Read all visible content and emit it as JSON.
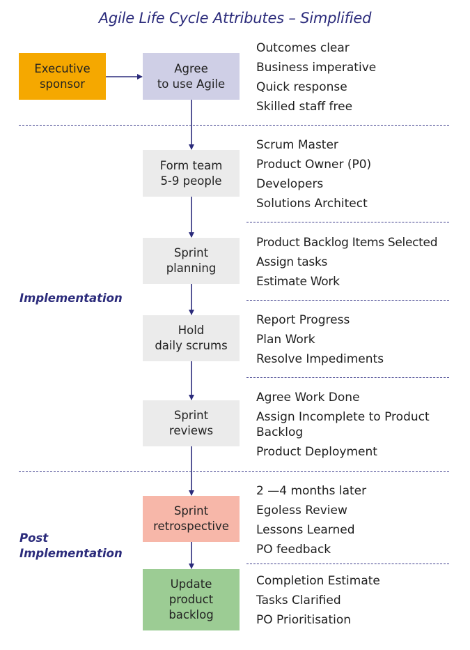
{
  "title": "Agile Life Cycle Attributes – Simplified",
  "colors": {
    "navy": "#2b2b7b",
    "executive_sponsor_fill": "#f5a800",
    "agree_fill": "#cfcfe6",
    "step_fill": "#ebebeb",
    "retrospective_fill": "#f7b7a9",
    "update_backlog_fill": "#9ccc94"
  },
  "phases": {
    "implementation": "Implementation",
    "post_implementation": "Post\nImplementation"
  },
  "nodes": {
    "executive_sponsor": {
      "label": "Executive\nsponsor"
    },
    "agree": {
      "label": "Agree\nto use Agile",
      "attributes": [
        "Outcomes clear",
        "Business imperative",
        "Quick response",
        "Skilled staff free"
      ]
    },
    "form_team": {
      "label": "Form team\n5-9 people",
      "attributes": [
        "Scrum Master",
        "Product Owner (P0)",
        "Developers",
        "Solutions Architect"
      ]
    },
    "sprint_planning": {
      "label": "Sprint\nplanning",
      "attributes": [
        "Product Backlog Items Selected",
        "Assign tasks",
        "Estimate Work"
      ]
    },
    "daily_scrums": {
      "label": "Hold\ndaily scrums",
      "attributes": [
        "Report Progress",
        "Plan Work",
        "Resolve Impediments"
      ]
    },
    "sprint_reviews": {
      "label": "Sprint\nreviews",
      "attributes": [
        "Agree Work Done",
        "Assign Incomplete to Product Backlog",
        "Product Deployment"
      ]
    },
    "sprint_retrospective": {
      "label": "Sprint\nretrospective",
      "attributes": [
        "2 —4 months later",
        "Egoless Review",
        "Lessons Learned",
        "PO feedback"
      ]
    },
    "update_backlog": {
      "label": "Update\nproduct\nbacklog",
      "attributes": [
        "Completion Estimate",
        "Tasks Clarified",
        "PO Prioritisation"
      ]
    }
  },
  "edges": [
    {
      "from": "executive_sponsor",
      "to": "agree"
    },
    {
      "from": "agree",
      "to": "form_team"
    },
    {
      "from": "form_team",
      "to": "sprint_planning"
    },
    {
      "from": "sprint_planning",
      "to": "daily_scrums"
    },
    {
      "from": "daily_scrums",
      "to": "sprint_reviews"
    },
    {
      "from": "sprint_reviews",
      "to": "sprint_retrospective"
    },
    {
      "from": "sprint_retrospective",
      "to": "update_backlog"
    }
  ]
}
